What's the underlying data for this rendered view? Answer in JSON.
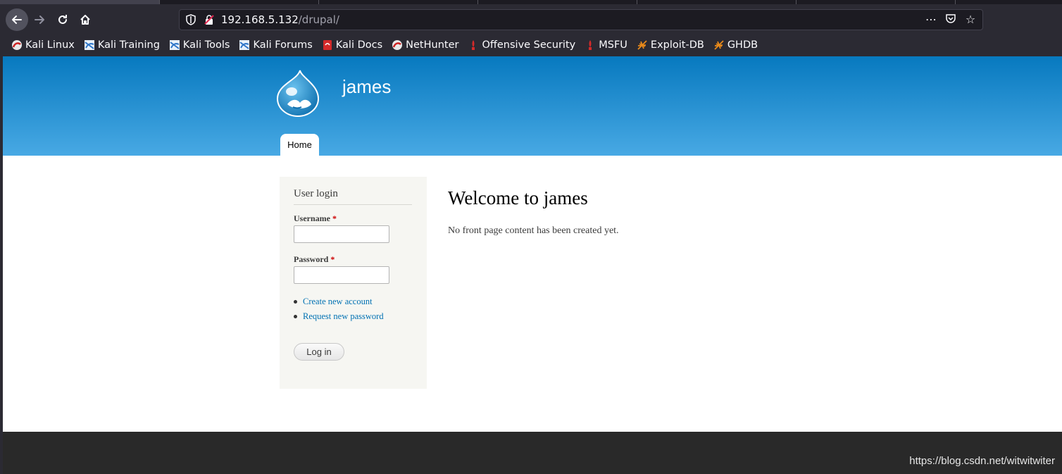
{
  "browser": {
    "url_host": "192.168.5.132",
    "url_path": "/drupal/",
    "bookmarks": [
      {
        "label": "Kali Linux",
        "icon": "kali-dragon-icon"
      },
      {
        "label": "Kali Training",
        "icon": "kali-training-icon"
      },
      {
        "label": "Kali Tools",
        "icon": "kali-tools-icon"
      },
      {
        "label": "Kali Forums",
        "icon": "kali-forums-icon"
      },
      {
        "label": "Kali Docs",
        "icon": "kali-docs-icon"
      },
      {
        "label": "NetHunter",
        "icon": "nethunter-icon"
      },
      {
        "label": "Offensive Security",
        "icon": "offsec-icon"
      },
      {
        "label": "MSFU",
        "icon": "msfu-icon"
      },
      {
        "label": "Exploit-DB",
        "icon": "exploitdb-icon"
      },
      {
        "label": "GHDB",
        "icon": "ghdb-icon"
      }
    ]
  },
  "site": {
    "name": "james",
    "nav": {
      "home": "Home"
    }
  },
  "login": {
    "title": "User login",
    "username_label": "Username",
    "password_label": "Password",
    "required_marker": "*",
    "create_account": "Create new account",
    "request_password": "Request new password",
    "submit": "Log in"
  },
  "main": {
    "title": "Welcome to james",
    "text": "No front page content has been created yet."
  },
  "watermark": "https://blog.csdn.net/witwitwiter",
  "colors": {
    "header_top": "#0779bf",
    "header_bottom": "#48a9e4",
    "link": "#0071b3",
    "sidebar_bg": "#f6f6f2",
    "footer": "#292929"
  }
}
